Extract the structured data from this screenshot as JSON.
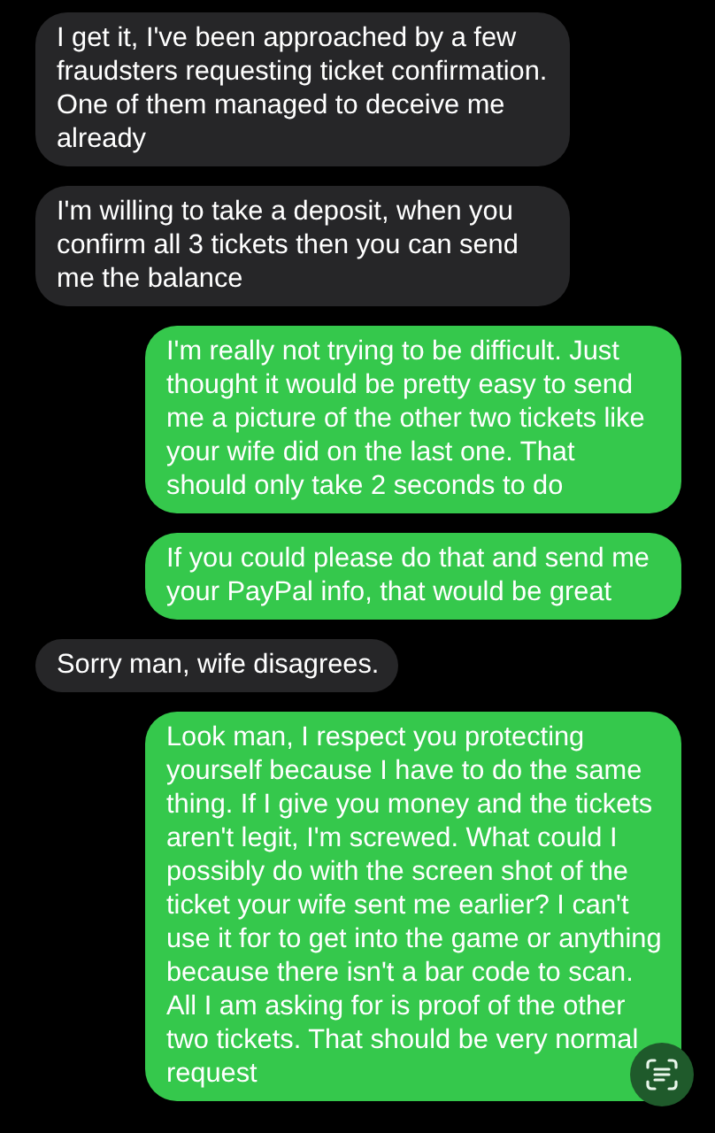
{
  "messages": [
    {
      "kind": "incoming",
      "text": "I get it, I've been approached by a few fraudsters requesting ticket confirmation. One of them managed to deceive me already"
    },
    {
      "kind": "incoming",
      "text": "I'm willing to take a deposit, when you confirm all 3 tickets then you can send me the balance"
    },
    {
      "kind": "outgoing",
      "text": "I'm really not trying to be difficult. Just thought it would be pretty easy to send me a picture of the other two tickets like your wife did on the last one. That should only take 2 seconds to do"
    },
    {
      "kind": "outgoing",
      "text": "If you could please do that and send me your PayPal info, that would be great"
    },
    {
      "kind": "incoming",
      "text": "Sorry man, wife disagrees."
    },
    {
      "kind": "outgoing",
      "text": "Look man, I respect you protecting yourself because I have to do the same thing. If I give you money and the tickets aren't legit, I'm screwed. What could I possibly do with the screen shot of the ticket your wife sent me earlier? I can't use it for to get into the game or anything because there isn't a bar code to scan. All I am asking for is proof of the other two tickets. That should be very normal request"
    }
  ]
}
